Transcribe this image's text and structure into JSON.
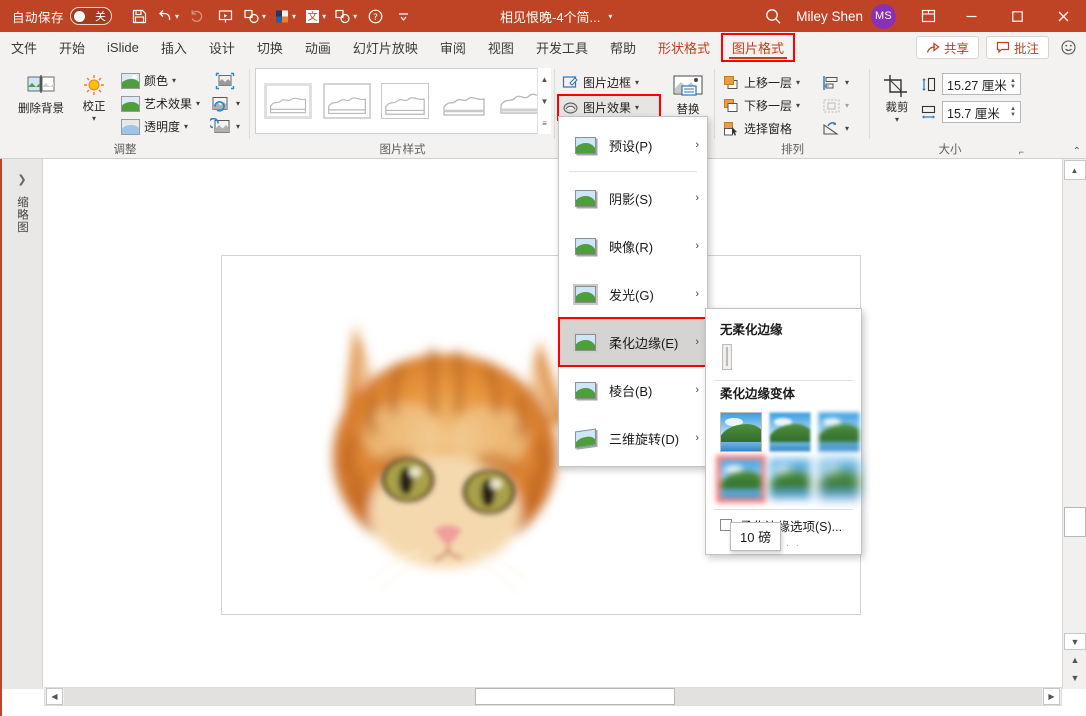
{
  "titlebar": {
    "autosave_label": "自动保存",
    "autosave_state": "关",
    "doc_title": "相见恨晚-4个简...",
    "user_name": "Miley Shen",
    "avatar_initials": "MS",
    "icons": [
      "save-icon",
      "undo-icon",
      "redo-icon",
      "start-presentation-icon",
      "shape-icon",
      "color-palette-icon",
      "chinese-input-icon",
      "shape2-icon",
      "help-icon",
      "more-commands-icon"
    ],
    "search_icon": "search-icon",
    "ribbon_display_icon": "ribbon-display-options-icon",
    "minimize": "—",
    "maximize": "□",
    "close": "✕",
    "accent_color": "#BF4425"
  },
  "tabs": [
    {
      "label": "文件",
      "style": "normal"
    },
    {
      "label": "开始",
      "style": "normal"
    },
    {
      "label": "iSlide",
      "style": "normal"
    },
    {
      "label": "插入",
      "style": "normal"
    },
    {
      "label": "设计",
      "style": "normal"
    },
    {
      "label": "切换",
      "style": "normal"
    },
    {
      "label": "动画",
      "style": "normal"
    },
    {
      "label": "幻灯片放映",
      "style": "normal"
    },
    {
      "label": "审阅",
      "style": "normal"
    },
    {
      "label": "视图",
      "style": "normal"
    },
    {
      "label": "开发工具",
      "style": "normal"
    },
    {
      "label": "帮助",
      "style": "normal"
    },
    {
      "label": "形状格式",
      "style": "accent"
    },
    {
      "label": "图片格式",
      "style": "active"
    }
  ],
  "tabbar_right": {
    "share_label": "共享",
    "comment_label": "批注",
    "feedback_icon": "smiley-icon"
  },
  "ribbon": {
    "groups": [
      {
        "name": "调整",
        "label": "调整",
        "big_buttons": [
          {
            "label": "删除背景",
            "icon": "remove-background-icon"
          },
          {
            "label": "校正",
            "icon": "corrections-icon",
            "has_dropdown": true
          }
        ],
        "small_buttons": [
          {
            "label": "颜色",
            "icon": "color-icon",
            "has_dropdown": true
          },
          {
            "label": "艺术效果",
            "icon": "artistic-effects-icon",
            "has_dropdown": true
          },
          {
            "label": "透明度",
            "icon": "transparency-icon",
            "has_dropdown": true
          }
        ],
        "icon_buttons": [
          {
            "icon": "compress-pictures-icon",
            "has_dropdown": false
          },
          {
            "icon": "change-picture-icon",
            "has_dropdown": true
          },
          {
            "icon": "reset-picture-icon",
            "has_dropdown": true
          }
        ]
      },
      {
        "name": "图片样式",
        "label": "图片样式",
        "gallery_count": 5,
        "scroll_up": "▲",
        "scroll_down": "▼",
        "more": "▾"
      },
      {
        "name": "图片效果组",
        "label": "",
        "small_buttons": [
          {
            "label": "图片边框",
            "icon": "picture-border-icon",
            "has_dropdown": true
          },
          {
            "label": "图片效果",
            "icon": "picture-effects-icon",
            "has_dropdown": true,
            "highlighted": true
          }
        ],
        "big_buttons": [
          {
            "label": "替换",
            "icon": "picture-layout-icon"
          }
        ]
      },
      {
        "name": "排列",
        "label": "排列",
        "small_buttons": [
          {
            "label": "上移一层",
            "icon": "bring-forward-icon",
            "has_dropdown": true
          },
          {
            "label": "下移一层",
            "icon": "send-backward-icon",
            "has_dropdown": true
          },
          {
            "label": "选择窗格",
            "icon": "selection-pane-icon",
            "has_dropdown": false
          }
        ],
        "icon_buttons": [
          {
            "icon": "align-icon",
            "has_dropdown": true
          },
          {
            "icon": "group-icon",
            "has_dropdown": true,
            "disabled": true
          },
          {
            "icon": "rotate-icon",
            "has_dropdown": true
          }
        ]
      },
      {
        "name": "大小",
        "label": "大小",
        "big_buttons": [
          {
            "label": "裁剪",
            "icon": "crop-icon",
            "has_dropdown": true
          }
        ],
        "fields": [
          {
            "icon": "height-icon",
            "value": "15.27 厘米",
            "name": "shape-height"
          },
          {
            "icon": "width-icon",
            "value": "15.7 厘米",
            "name": "shape-width"
          }
        ],
        "dialog_launcher": "dialog-launcher-icon"
      }
    ],
    "collapse_icon": "collapse-ribbon-icon"
  },
  "thumbnail_pane": {
    "expand_icon": "chevron-right-icon",
    "label": "缩略图"
  },
  "slide": {
    "image_alt": "orange-tabby-cat-face"
  },
  "menu": {
    "items": [
      {
        "label": "预设(P)",
        "arrow": "›",
        "icon": "preset-icon",
        "highlighted": false
      },
      {
        "label": "阴影(S)",
        "arrow": "›",
        "icon": "shadow-icon",
        "highlighted": false
      },
      {
        "label": "映像(R)",
        "arrow": "›",
        "icon": "reflection-icon",
        "highlighted": false
      },
      {
        "label": "发光(G)",
        "arrow": "›",
        "icon": "glow-icon",
        "highlighted": false
      },
      {
        "label": "柔化边缘(E)",
        "arrow": "›",
        "icon": "soft-edges-icon",
        "highlighted": true
      },
      {
        "label": "棱台(B)",
        "arrow": "›",
        "icon": "bevel-icon",
        "highlighted": false
      },
      {
        "label": "三维旋转(D)",
        "arrow": "›",
        "icon": "3d-rotation-icon",
        "highlighted": false
      }
    ]
  },
  "submenu": {
    "none_heading": "无柔化边缘",
    "variants_heading": "柔化边缘变体",
    "variants_count": 6,
    "selected_variant_index": 3,
    "footer_label": "柔化边缘选项(S)...",
    "grip": "· · · ·",
    "tooltip": "10 磅"
  },
  "scrollbars": {
    "v_up": "▲",
    "v_down": "▼",
    "prev_slide": "▲",
    "next_slide": "▼",
    "h_left": "◀",
    "h_right": "▶"
  },
  "colors": {
    "titlebar": "#BF4425",
    "ribbon_bg": "#F3F2F1",
    "accent_text": "#C43E1C",
    "highlight_box": "#FF0000",
    "avatar": "#8B2FB8"
  }
}
